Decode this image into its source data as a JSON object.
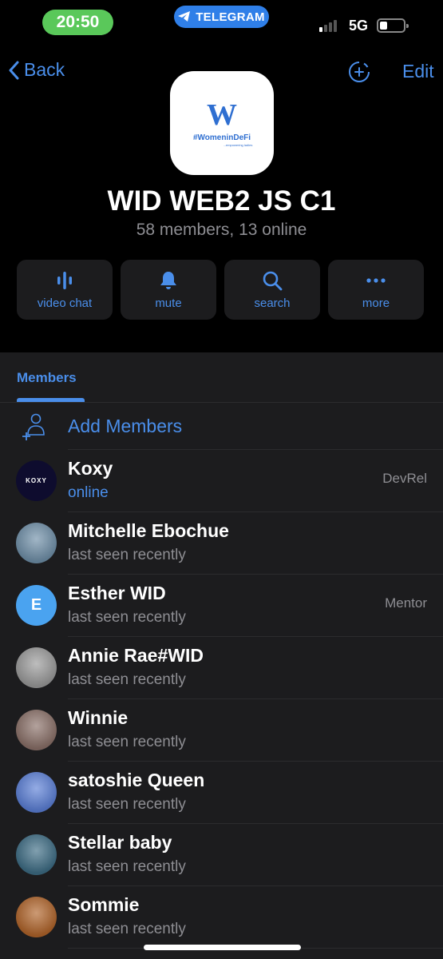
{
  "status_bar": {
    "time": "20:50",
    "app_pill": "TELEGRAM",
    "network": "5G",
    "signal_bars_active": 1,
    "signal_bars_total": 4,
    "battery_level": 0.25
  },
  "nav": {
    "back_label": "Back",
    "edit_label": "Edit"
  },
  "group": {
    "avatar_logo_text": "#WomeninDeFi",
    "avatar_logo_mark": "W",
    "avatar_logo_sub": "...empowering ladies",
    "title": "WID WEB2 JS C1",
    "subtitle": "58 members, 13 online"
  },
  "actions": [
    {
      "icon": "voice-chat-icon",
      "label": "video chat"
    },
    {
      "icon": "bell-icon",
      "label": "mute"
    },
    {
      "icon": "search-icon",
      "label": "search"
    },
    {
      "icon": "more-icon",
      "label": "more"
    }
  ],
  "members_tab": {
    "tab_label": "Members",
    "add_label": "Add Members"
  },
  "members": [
    {
      "name": "Koxy",
      "status": "online",
      "role": "DevRel",
      "avatar_text": "KOXY",
      "avatar_color": "#0e0c2e"
    },
    {
      "name": "Mitchelle Ebochue",
      "status": "last seen recently",
      "role": "",
      "avatar_text": "",
      "avatar_color": "#6f8fa8"
    },
    {
      "name": "Esther WID",
      "status": "last seen recently",
      "role": "Mentor",
      "avatar_text": "E",
      "avatar_color": "#4aa3f0"
    },
    {
      "name": "Annie Rae#WID",
      "status": "last seen recently",
      "role": "",
      "avatar_text": "",
      "avatar_color": "#9a9a9a"
    },
    {
      "name": "Winnie",
      "status": "last seen recently",
      "role": "",
      "avatar_text": "",
      "avatar_color": "#8a7068"
    },
    {
      "name": "satoshie Queen",
      "status": "last seen recently",
      "role": "",
      "avatar_text": "",
      "avatar_color": "#5b7fd6"
    },
    {
      "name": "Stellar baby",
      "status": "last seen recently",
      "role": "",
      "avatar_text": "",
      "avatar_color": "#3d6c84"
    },
    {
      "name": "Sommie",
      "status": "last seen recently",
      "role": "",
      "avatar_text": "",
      "avatar_color": "#b0642a"
    }
  ],
  "colors": {
    "accent": "#4a8eea",
    "online": "#4a8eea",
    "secondary_text": "#8e8e93",
    "panel_bg": "#1c1c1e",
    "time_pill": "#5ac85a",
    "telegram_pill": "#2f7fe8"
  }
}
